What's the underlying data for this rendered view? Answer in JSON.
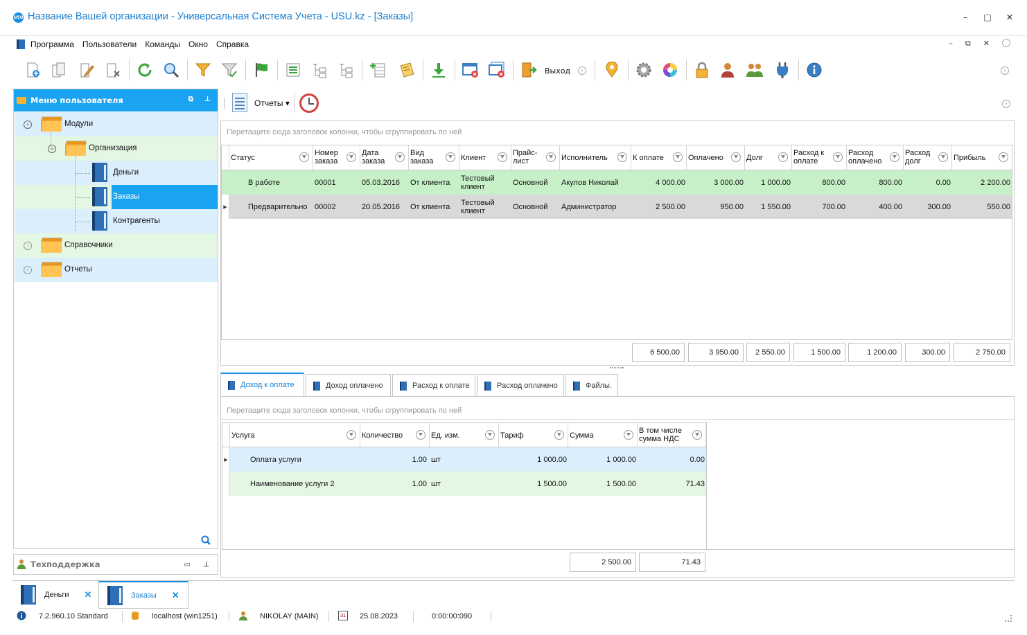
{
  "window": {
    "title": "Название Вашей организации - Универсальная Система Учета - USU.kz - [Заказы]",
    "logo_text": "USU",
    "controls": [
      "–",
      "□",
      "✕"
    ]
  },
  "menu": {
    "items": [
      "Программа",
      "Пользователи",
      "Команды",
      "Окно",
      "Справка"
    ],
    "mdi_controls": [
      "–",
      "⧉",
      "✕"
    ]
  },
  "toolbar": {
    "exit_label": "Выход",
    "icons": [
      "add-icon",
      "copy-icon",
      "edit-icon",
      "delete-icon",
      "refresh-icon",
      "search-icon",
      "filter-icon",
      "filter-settings-icon",
      "flag-icon",
      "expand-icon",
      "tree-down-icon",
      "tree-up-icon",
      "add-row-icon",
      "notes-icon",
      "download-icon",
      "close-window-icon",
      "close-all-icon",
      "exit-icon",
      "location-icon",
      "settings-icon",
      "color-icon",
      "lock-icon",
      "user-icon",
      "users-icon",
      "plugin-icon",
      "info-icon"
    ]
  },
  "left_panel": {
    "title": "Меню пользователя",
    "tree": {
      "modules": "Модули",
      "organization": "Организация",
      "money": "Деньги",
      "orders": "Заказы",
      "contractors": "Контрагенты",
      "references": "Справочники",
      "reports": "Отчеты"
    },
    "support_title": "Техподдержка"
  },
  "subtoolbar": {
    "reports_label": "Отчеты ▾"
  },
  "orders_grid": {
    "group_hint": "Перетащите сюда заголовок колонки, чтобы сгруппировать по ней",
    "columns": [
      "Статус",
      "Номер заказа",
      "Дата заказа",
      "Вид заказа",
      "Клиент",
      "Прайс-лист",
      "Исполнитель",
      "К оплате",
      "Оплачено",
      "Долг",
      "Расход к оплате",
      "Расход оплачено",
      "Расход долг",
      "Прибыль"
    ],
    "rows": [
      {
        "status": "В работе",
        "number": "00001",
        "date": "05.03.2016",
        "kind": "От клиента",
        "client": "Тестовый клиент",
        "price_list": "Основной",
        "executor": "Акулов Николай",
        "to_pay": "4 000.00",
        "paid": "3 000.00",
        "debt": "1 000.00",
        "exp_to_pay": "800.00",
        "exp_paid": "800.00",
        "exp_debt": "0.00",
        "profit": "2 200.00"
      },
      {
        "status": "Предварительно",
        "number": "00002",
        "date": "20.05.2016",
        "kind": "От клиента",
        "client": "Тестовый клиент",
        "price_list": "Основной",
        "executor": "Администратор",
        "to_pay": "2 500.00",
        "paid": "950.00",
        "debt": "1 550.00",
        "exp_to_pay": "700.00",
        "exp_paid": "400.00",
        "exp_debt": "300.00",
        "profit": "550.00"
      }
    ],
    "totals": {
      "to_pay": "6 500.00",
      "paid": "3 950.00",
      "debt": "2 550.00",
      "exp_to_pay": "1 500.00",
      "exp_paid": "1 200.00",
      "exp_debt": "300.00",
      "profit": "2 750.00"
    }
  },
  "detail_tabs": [
    "Доход к оплате",
    "Доход оплачено",
    "Расход к оплате",
    "Расход оплачено",
    "Файлы."
  ],
  "services_grid": {
    "group_hint": "Перетащите сюда заголовок колонки, чтобы сгруппировать по ней",
    "columns": [
      "Услуга",
      "Количество",
      "Ед. изм.",
      "Тариф",
      "Сумма",
      "В том числе сумма НДС"
    ],
    "rows": [
      {
        "service": "Оплата услуги",
        "qty": "1.00",
        "unit": "шт",
        "tariff": "1 000.00",
        "sum": "1 000.00",
        "vat": "0.00"
      },
      {
        "service": "Наименование услуги 2",
        "qty": "1.00",
        "unit": "шт",
        "tariff": "1 500.00",
        "sum": "1 500.00",
        "vat": "71.43"
      }
    ],
    "totals": {
      "sum": "2 500.00",
      "vat": "71.43"
    }
  },
  "doc_tabs": [
    {
      "label": "Деньги",
      "close": "✕"
    },
    {
      "label": "Заказы",
      "close": "✕"
    }
  ],
  "status": {
    "version": "7.2.960.10 Standard",
    "server": "localhost (win1251)",
    "user": "NIKOLAY (MAIN)",
    "date": "25.08.2023",
    "timer": "0:00:00:090",
    "calendar_day": "31"
  },
  "colors": {
    "accent": "#1aa3f0",
    "selected_row": "#c8f0c8",
    "alt_row": "#d9d9d9",
    "tree_blue": "#dbeefb",
    "tree_green": "#e3f7e3"
  }
}
